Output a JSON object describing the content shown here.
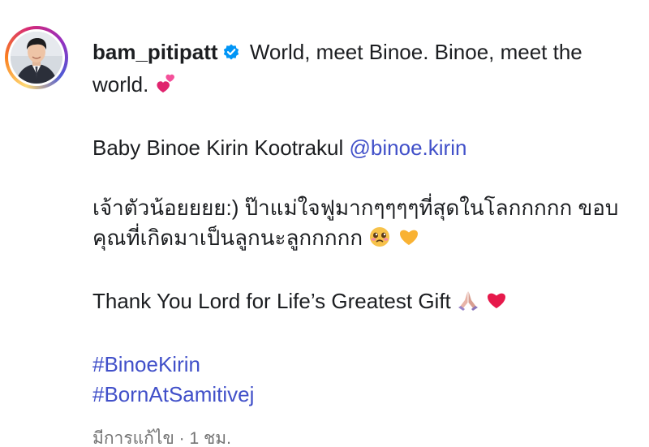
{
  "post": {
    "username": "bam_pitipatt",
    "caption_line_1": "World, meet Binoe. Binoe, meet the",
    "caption_line_2": "world.",
    "baby_text": "Baby Binoe Kirin Kootrakul",
    "mention": "@binoe.kirin",
    "thai_line_1": "เจ้าตัวน้อยยยย:) ป๊าแม่ใจฟูมากๆๆๆๆที่สุดในโลกกกกก ขอบ",
    "thai_line_2": "คุณที่เกิดมาเป็นลูกนะลูกกกกก",
    "thanks_text": "Thank You Lord for Life’s Greatest Gift",
    "hashtags": [
      "#BinoeKirin",
      "#BornAtSamitivej"
    ],
    "meta_text": "มีการแก้ไข · 1 ชม.",
    "icons": {
      "verified": "verified-badge-icon",
      "hearts": "two-hearts-emoji",
      "crying_face": "crying-face-emoji",
      "yellow_heart": "yellow-heart-emoji",
      "praying_hands": "praying-hands-emoji",
      "red_heart": "red-heart-emoji"
    },
    "colors": {
      "link": "#4150c9",
      "verified": "#0095f6",
      "meta": "#737373"
    }
  }
}
